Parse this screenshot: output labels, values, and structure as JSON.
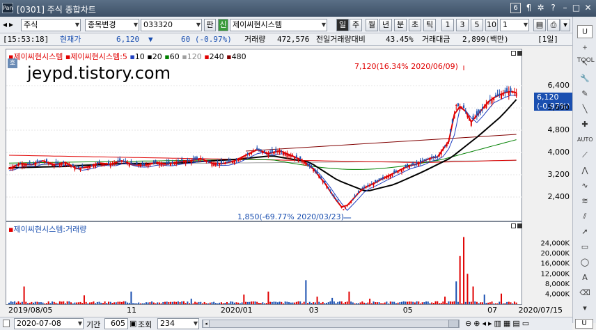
{
  "window": {
    "code": "[0301]",
    "title": "주식 종합차트",
    "logo": "Pan",
    "window_number": "6"
  },
  "toolbar": {
    "market": "주식",
    "change_item": "종목변경",
    "code": "033320",
    "search_btn": "판",
    "credit_badge": "신",
    "stock_name": "제이씨현시스템",
    "periods": [
      "일",
      "주",
      "월",
      "년",
      "분",
      "초",
      "틱"
    ],
    "intervals": [
      "1",
      "3",
      "5",
      "10"
    ],
    "interval_value": "1",
    "colors": {
      "selected": "#2b2b2b"
    }
  },
  "infobar": {
    "time": "[15:53:18]",
    "label_price": "현재가",
    "price": "6,120",
    "arrow": "▼",
    "change": "60 (-0.97%)",
    "label_volume": "거래량",
    "volume": "472,576",
    "label_prevratio": "전일거래량대비",
    "prevratio": "43.45%",
    "label_amount": "거래대금",
    "amount": "2,899(백만)",
    "period": "[1일]"
  },
  "price_panel": {
    "legend": [
      {
        "text": "제이씨현시스템",
        "color": "#e00000"
      },
      {
        "text": "제이씨현시스템:5",
        "color": "#e00000"
      },
      {
        "text": "10",
        "color": "#2040c0"
      },
      {
        "text": "20",
        "color": "#000000"
      },
      {
        "text": "60",
        "color": "#008000"
      },
      {
        "text": "120",
        "color": "#a0a0a0"
      },
      {
        "text": "240",
        "color": "#e00000"
      },
      {
        "text": "480",
        "color": "#800000"
      }
    ],
    "badge": "호",
    "watermark": "jeypd.tistory.com",
    "high_note": "7,120(16.34% 2020/06/09)",
    "low_note": "1,850(-69.77% 2020/03/23)",
    "current_label": "6,120",
    "current_change": "(-0.97%)"
  },
  "volume_panel": {
    "legend": "제이씨현시스템:거래량"
  },
  "bottombar": {
    "date": "2020-07-08",
    "label_period": "기간",
    "period_value": "605",
    "label_view": "조회",
    "view_value": "234"
  },
  "righttools": [
    "U",
    "+ TOOL",
    "AUTO"
  ],
  "chart_data": [
    {
      "type": "candlestick",
      "title": "제이씨현시스템",
      "x_ticks": [
        "2019/08/05",
        "11",
        "2020/01",
        "03",
        "05",
        "07",
        "2020/07/15"
      ],
      "y_ticks": [
        2400,
        3200,
        4000,
        4800,
        5600,
        6400
      ],
      "ylim": [
        1700,
        7300
      ],
      "series": [
        {
          "name": "제이씨현시스템",
          "points": [
            [
              0,
              3420
            ],
            [
              6,
              3600
            ],
            [
              12,
              3560
            ],
            [
              18,
              3700
            ],
            [
              24,
              3560
            ],
            [
              30,
              3640
            ],
            [
              36,
              3420
            ],
            [
              42,
              3480
            ],
            [
              48,
              3620
            ],
            [
              54,
              3580
            ],
            [
              60,
              3700
            ],
            [
              66,
              3560
            ],
            [
              72,
              3540
            ],
            [
              78,
              3640
            ],
            [
              84,
              3580
            ],
            [
              90,
              3660
            ],
            [
              96,
              3700
            ],
            [
              102,
              3780
            ],
            [
              108,
              3620
            ],
            [
              114,
              3600
            ],
            [
              120,
              3700
            ],
            [
              126,
              3900
            ],
            [
              132,
              4100
            ],
            [
              138,
              3960
            ],
            [
              144,
              4060
            ],
            [
              150,
              3900
            ],
            [
              156,
              3720
            ],
            [
              162,
              3400
            ],
            [
              168,
              2900
            ],
            [
              174,
              2300
            ],
            [
              178,
              1960
            ],
            [
              182,
              2240
            ],
            [
              188,
              2700
            ],
            [
              194,
              2880
            ],
            [
              200,
              3100
            ],
            [
              206,
              3300
            ],
            [
              212,
              3500
            ],
            [
              218,
              3600
            ],
            [
              224,
              3800
            ],
            [
              228,
              3840
            ],
            [
              234,
              4400
            ],
            [
              238,
              5700
            ],
            [
              242,
              5600
            ],
            [
              246,
              5100
            ],
            [
              250,
              5400
            ],
            [
              256,
              5900
            ],
            [
              262,
              6100
            ],
            [
              266,
              6200
            ],
            [
              270,
              6150
            ]
          ]
        },
        {
          "name": "20",
          "points": [
            [
              0,
              3450
            ],
            [
              30,
              3500
            ],
            [
              60,
              3600
            ],
            [
              90,
              3620
            ],
            [
              120,
              3750
            ],
            [
              140,
              3880
            ],
            [
              160,
              3650
            ],
            [
              175,
              3000
            ],
            [
              190,
              2600
            ],
            [
              205,
              2850
            ],
            [
              220,
              3300
            ],
            [
              235,
              3800
            ],
            [
              250,
              4600
            ],
            [
              262,
              5300
            ],
            [
              270,
              5900
            ]
          ]
        }
      ],
      "high": {
        "value": 7120,
        "change": "16.34%",
        "date": "2020/06/09"
      },
      "low": {
        "value": 1850,
        "change": "-69.77%",
        "date": "2020/03/23"
      },
      "current": {
        "value": 6120,
        "change": "-0.97%"
      }
    },
    {
      "type": "bar",
      "title": "제이씨현시스템:거래량",
      "y_ticks_label": [
        "4,000K",
        "8,000K",
        "12,000K",
        "16,000K",
        "20,000K",
        "24,000K"
      ],
      "ylim": [
        0,
        28000
      ],
      "unit": "K",
      "spikes": [
        [
          8,
          7000
        ],
        [
          40,
          3500
        ],
        [
          65,
          5000
        ],
        [
          97,
          2200
        ],
        [
          125,
          3800
        ],
        [
          138,
          5000
        ],
        [
          158,
          9500
        ],
        [
          164,
          3000
        ],
        [
          172,
          2500
        ],
        [
          181,
          5000
        ],
        [
          192,
          2200
        ],
        [
          232,
          3000
        ],
        [
          238,
          9000
        ],
        [
          240,
          19000
        ],
        [
          242,
          26500
        ],
        [
          244,
          12000
        ],
        [
          247,
          7000
        ],
        [
          253,
          3800
        ],
        [
          262,
          4200
        ]
      ]
    }
  ]
}
